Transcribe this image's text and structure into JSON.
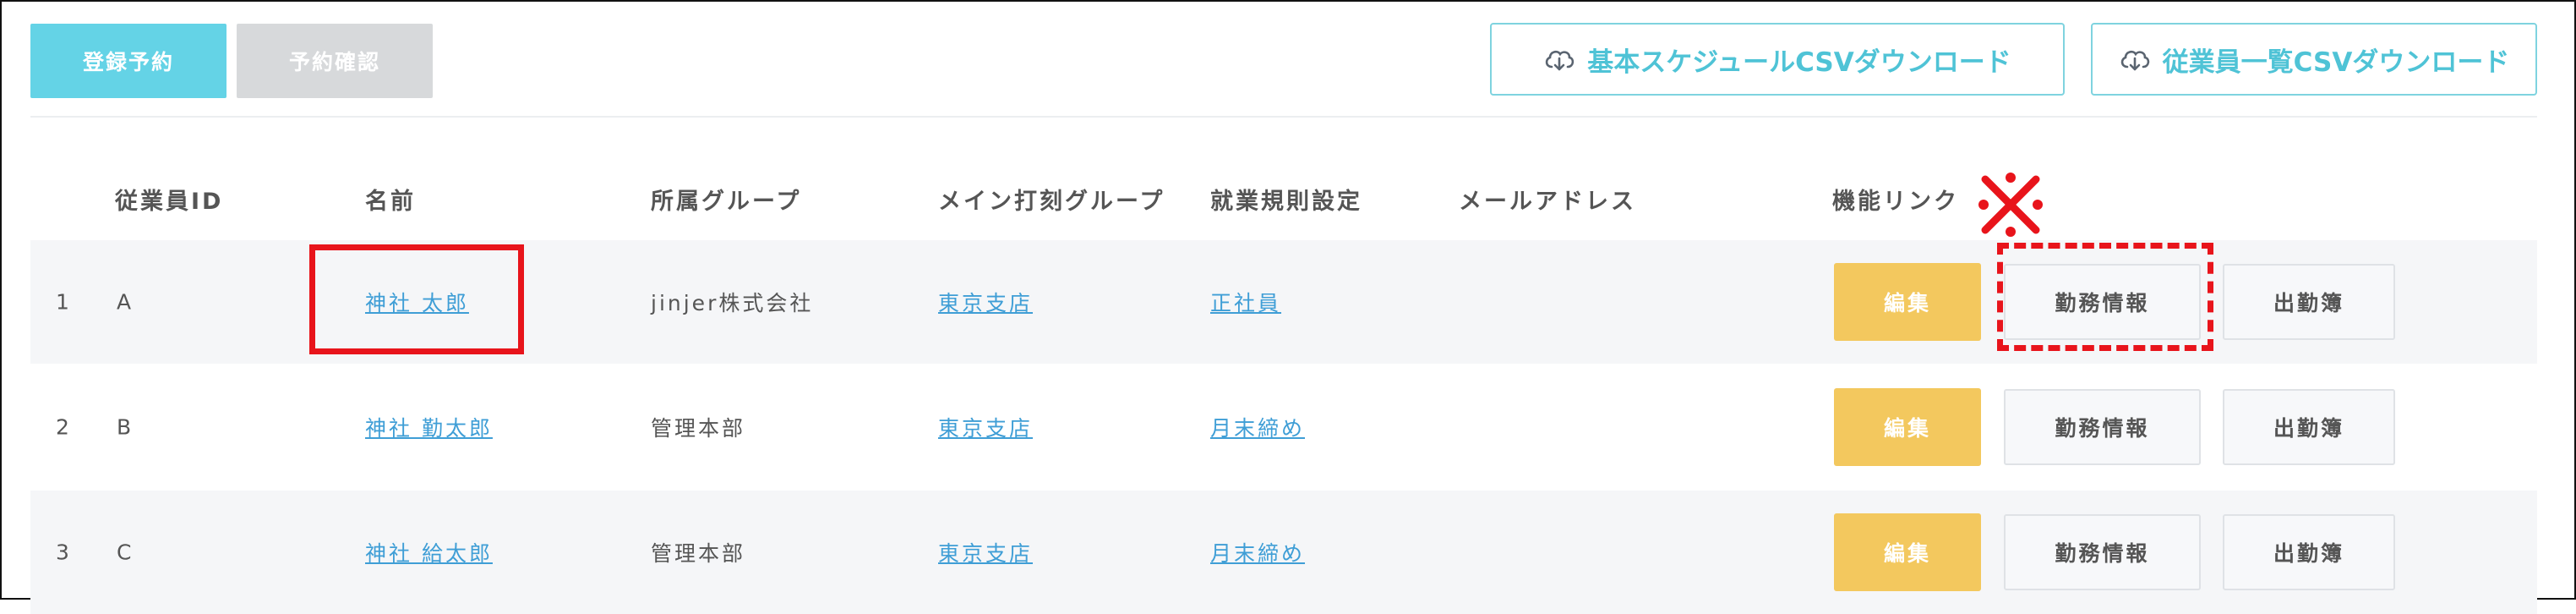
{
  "toolbar": {
    "register_label": "登録予約",
    "confirm_label": "予約確認",
    "csv_basic_label": "基本スケジュールCSVダウンロード",
    "csv_employees_label": "従業員一覧CSVダウンロード"
  },
  "table": {
    "headers": {
      "id": "従業員ID",
      "name": "名前",
      "group": "所属グループ",
      "stamp_group": "メイン打刻グループ",
      "rules": "就業規則設定",
      "email": "メールアドレス",
      "links": "機能リンク"
    },
    "rows": [
      {
        "no": "1",
        "id": "A",
        "name": "神社 太郎",
        "group": "jinjer株式会社",
        "stamp_group": "東京支店",
        "rules": "正社員",
        "email": "",
        "edit": "編集",
        "work": "勤務情報",
        "attend": "出勤簿"
      },
      {
        "no": "2",
        "id": "B",
        "name": "神社 勤太郎",
        "group": "管理本部",
        "stamp_group": "東京支店",
        "rules": "月末締め",
        "email": "",
        "edit": "編集",
        "work": "勤務情報",
        "attend": "出勤簿"
      },
      {
        "no": "3",
        "id": "C",
        "name": "神社 給太郎",
        "group": "管理本部",
        "stamp_group": "東京支店",
        "rules": "月末締め",
        "email": "",
        "edit": "編集",
        "work": "勤務情報",
        "attend": "出勤簿"
      }
    ]
  },
  "annotation": {
    "mark": "※",
    "color": "#e8141b"
  },
  "colors": {
    "accent": "#64d3e6",
    "edit_button": "#f3c85e",
    "link": "#3f9ed6",
    "row_shade": "#f5f6f8"
  },
  "icons": {
    "csv_download": "cloud-download-icon"
  }
}
